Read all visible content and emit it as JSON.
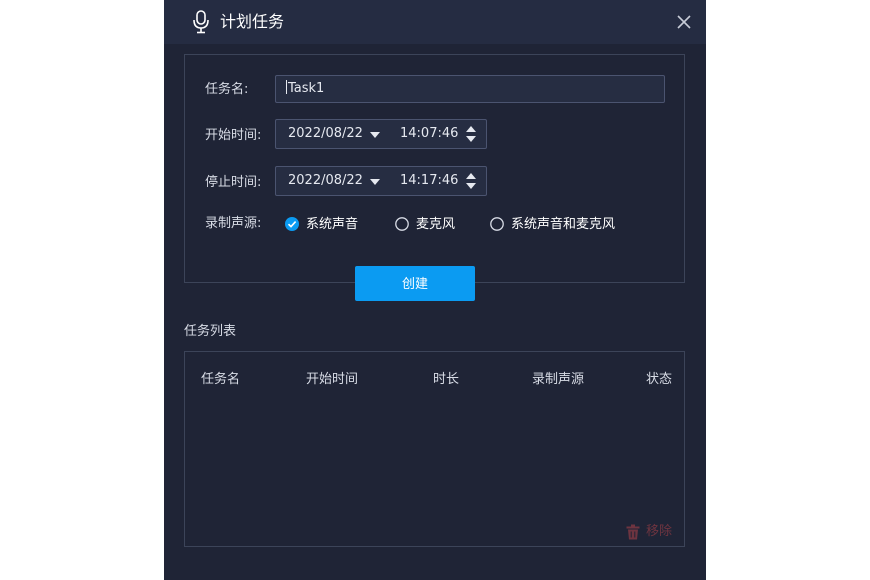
{
  "dialog": {
    "title": "计划任务",
    "title_icon": "microphone-icon",
    "close_icon": "close-icon"
  },
  "form": {
    "task_name_label": "任务名:",
    "task_name_value": "Task1",
    "start_label": "开始时间:",
    "start_date": "2022/08/22",
    "start_time": "14:07:46",
    "stop_label": "停止时间:",
    "stop_date": "2022/08/22",
    "stop_time": "14:17:46",
    "source_label": "录制声源:",
    "sources": [
      {
        "label": "系统声音",
        "checked": true
      },
      {
        "label": "麦克风",
        "checked": false
      },
      {
        "label": "系统声音和麦克风",
        "checked": false
      }
    ],
    "create_label": "创建"
  },
  "task_list": {
    "title": "任务列表",
    "columns": [
      "任务名",
      "开始时间",
      "时长",
      "录制声源",
      "状态"
    ],
    "rows": [],
    "remove_label": "移除",
    "remove_icon": "trash-icon"
  },
  "colors": {
    "background": "#1f2436",
    "titlebar": "#252c42",
    "accent": "#0b9bf2",
    "remove_text": "#6e3440"
  }
}
